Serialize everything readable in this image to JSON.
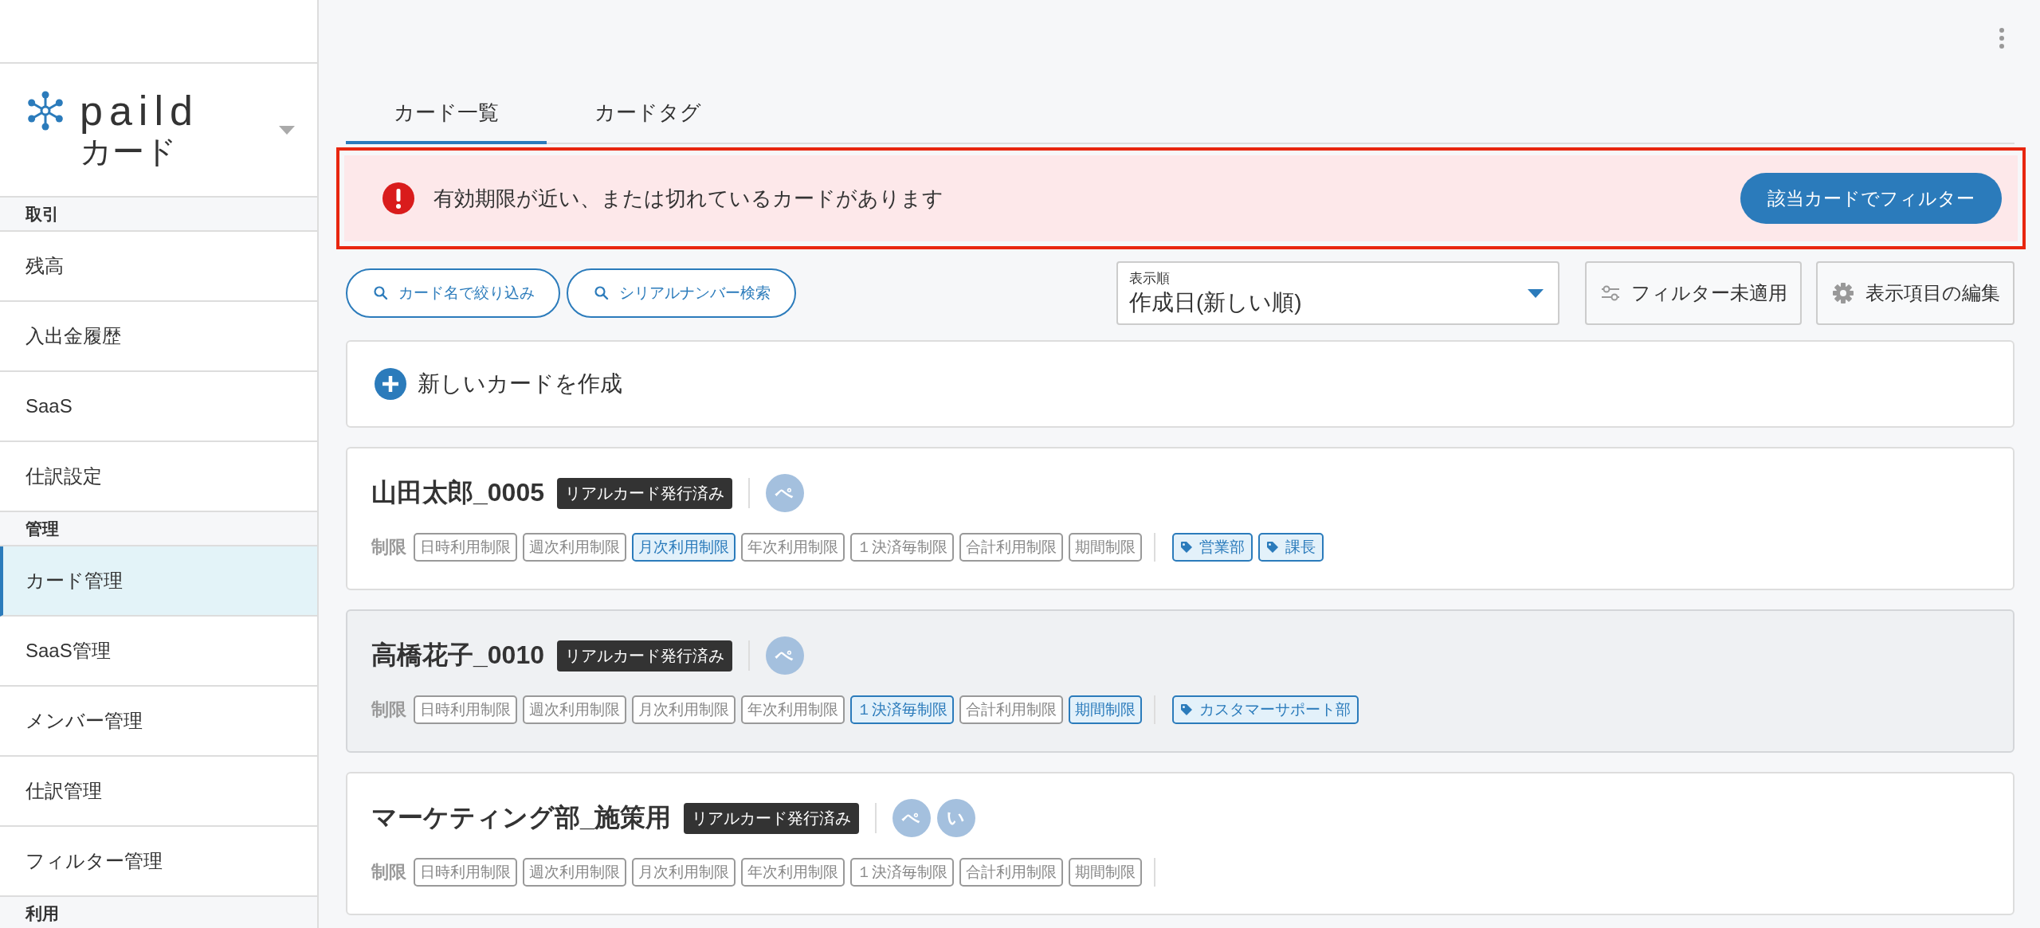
{
  "sidebar": {
    "logo": {
      "brand": "paild",
      "product": "カード"
    },
    "sections": [
      {
        "title": "取引",
        "items": [
          {
            "label": "残高",
            "selected": false
          },
          {
            "label": "入出金履歴",
            "selected": false
          },
          {
            "label": "SaaS",
            "selected": false
          },
          {
            "label": "仕訳設定",
            "selected": false
          }
        ]
      },
      {
        "title": "管理",
        "items": [
          {
            "label": "カード管理",
            "selected": true
          },
          {
            "label": "SaaS管理",
            "selected": false
          },
          {
            "label": "メンバー管理",
            "selected": false
          },
          {
            "label": "仕訳管理",
            "selected": false
          },
          {
            "label": "フィルター管理",
            "selected": false
          }
        ]
      },
      {
        "title": "利用"
      }
    ]
  },
  "tabs": [
    {
      "label": "カード一覧",
      "selected": true
    },
    {
      "label": "カードタグ",
      "selected": false
    }
  ],
  "alert": {
    "message": "有効期限が近い、または切れているカードがあります",
    "button": "該当カードでフィルター"
  },
  "toolbar": {
    "search_buttons": [
      "カード名で絞り込み",
      "シリアルナンバー検索"
    ],
    "sort": {
      "label": "表示順",
      "value": "作成日(新しい順)"
    },
    "filter_button": "フィルター未適用",
    "columns_button": "表示項目の編集"
  },
  "new_card": "新しいカードを作成",
  "cards": [
    {
      "name": "山田太郎_0005",
      "badge": "リアルカード発行済み",
      "hovered": false,
      "avatars": [
        "ぺ"
      ],
      "limits_label": "制限",
      "limits": [
        {
          "label": "日時利用制限",
          "active": false
        },
        {
          "label": "週次利用制限",
          "active": false
        },
        {
          "label": "月次利用制限",
          "active": true
        },
        {
          "label": "年次利用制限",
          "active": false
        },
        {
          "label": "１決済毎制限",
          "active": false
        },
        {
          "label": "合計利用制限",
          "active": false
        },
        {
          "label": "期間制限",
          "active": false
        }
      ],
      "tags": [
        "営業部",
        "課長"
      ]
    },
    {
      "name": "高橋花子_0010",
      "badge": "リアルカード発行済み",
      "hovered": true,
      "avatars": [
        "ぺ"
      ],
      "limits_label": "制限",
      "limits": [
        {
          "label": "日時利用制限",
          "active": false
        },
        {
          "label": "週次利用制限",
          "active": false
        },
        {
          "label": "月次利用制限",
          "active": false
        },
        {
          "label": "年次利用制限",
          "active": false
        },
        {
          "label": "１決済毎制限",
          "active": true
        },
        {
          "label": "合計利用制限",
          "active": false
        },
        {
          "label": "期間制限",
          "active": true
        }
      ],
      "tags": [
        "カスタマーサポート部"
      ]
    },
    {
      "name": "マーケティング部_施策用",
      "badge": "リアルカード発行済み",
      "hovered": false,
      "avatars": [
        "ぺ",
        "い"
      ],
      "limits_label": "制限",
      "limits": [
        {
          "label": "日時利用制限",
          "active": false
        },
        {
          "label": "週次利用制限",
          "active": false
        },
        {
          "label": "月次利用制限",
          "active": false
        },
        {
          "label": "年次利用制限",
          "active": false
        },
        {
          "label": "１決済毎制限",
          "active": false
        },
        {
          "label": "合計利用制限",
          "active": false
        },
        {
          "label": "期間制限",
          "active": false
        }
      ]
    }
  ]
}
